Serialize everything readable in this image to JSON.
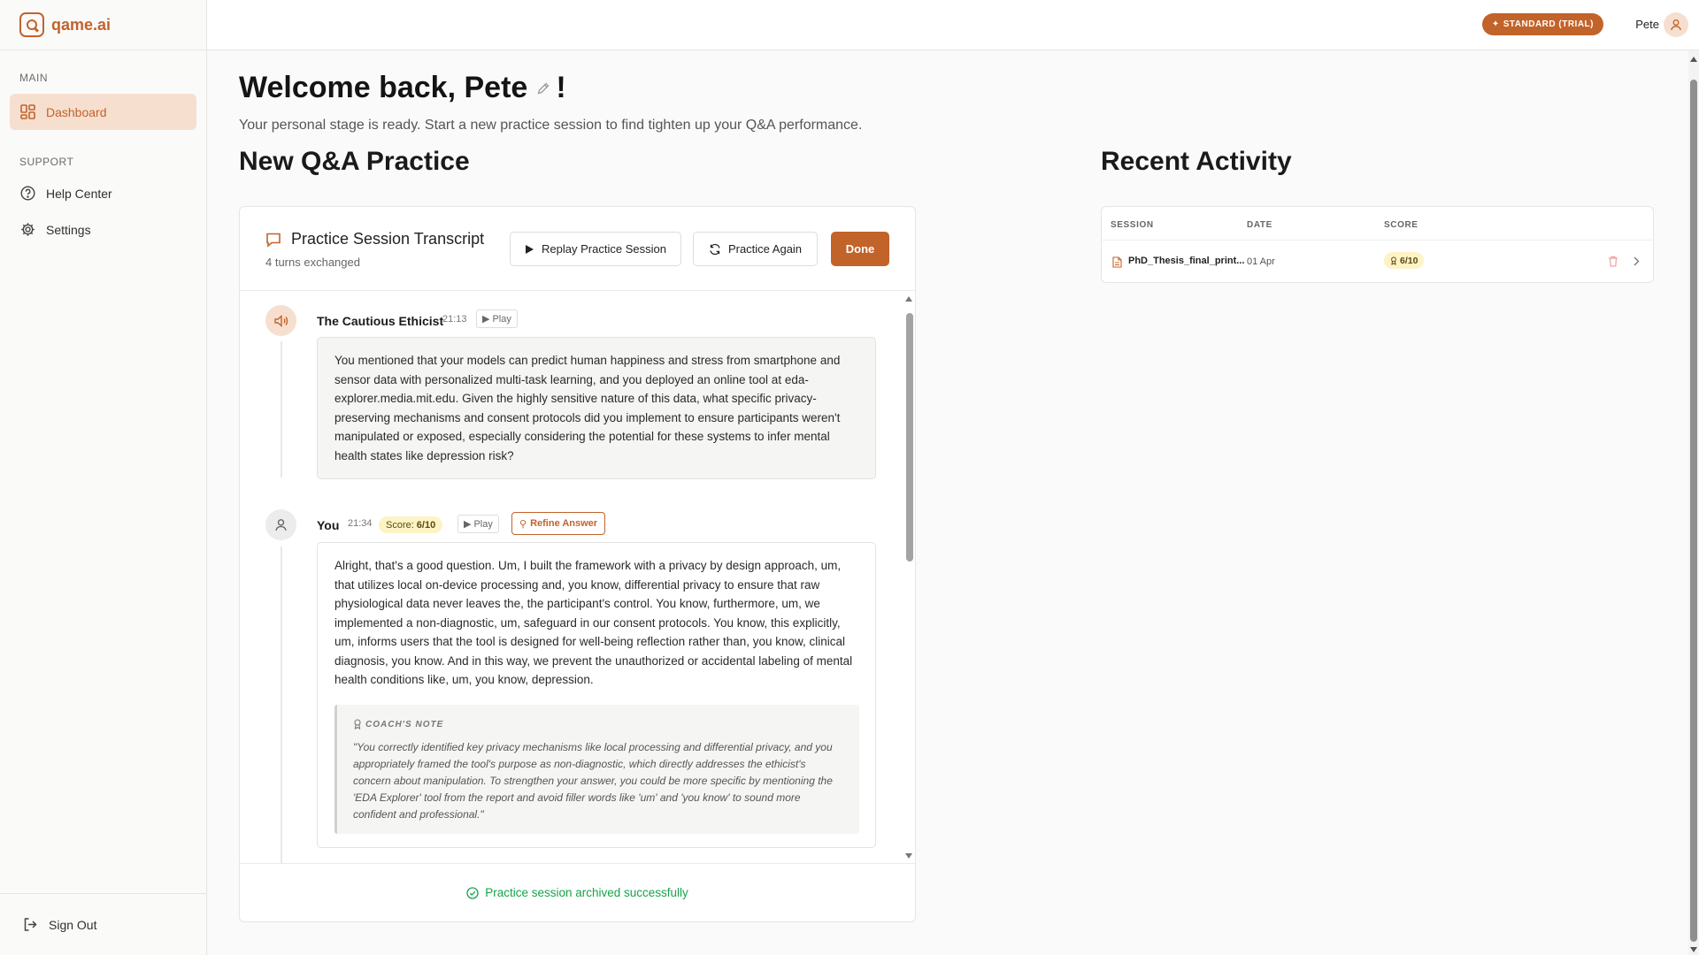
{
  "app": {
    "logo_text": "qame.ai"
  },
  "sidebar": {
    "sections": [
      {
        "label": "MAIN",
        "items": [
          {
            "label": "Dashboard",
            "icon": "dashboard-icon",
            "active": true
          }
        ]
      },
      {
        "label": "SUPPORT",
        "items": [
          {
            "label": "Help Center",
            "icon": "help-icon"
          },
          {
            "label": "Settings",
            "icon": "gear-icon"
          }
        ]
      }
    ],
    "sign_out": "Sign Out"
  },
  "topbar": {
    "plan_badge": "STANDARD (TRIAL)",
    "user_name": "Pete"
  },
  "welcome": {
    "prefix": "Welcome back, ",
    "name": "Pete",
    "suffix": "!",
    "subtitle": "Your personal stage is ready. Start a new practice session to find tighten up your Q&A performance."
  },
  "practice": {
    "section_title": "New Q&A Practice",
    "card_title": "Practice Session Transcript",
    "turns_count": "4 turns exchanged",
    "buttons": {
      "replay": "Replay Practice Session",
      "again": "Practice Again",
      "done": "Done"
    },
    "turns": [
      {
        "speaker": "The Cautious Ethicist",
        "time": "21:13",
        "play": "Play",
        "text": "You mentioned that your models can predict human happiness and stress from smartphone and sensor data with personalized multi-task learning, and you deployed an online tool at eda-explorer.media.mit.edu. Given the highly sensitive nature of this data, what specific privacy-preserving mechanisms and consent protocols did you implement to ensure participants weren't manipulated or exposed, especially considering the potential for these systems to infer mental health states like depression risk?"
      },
      {
        "speaker": "You",
        "time": "21:34",
        "score_label": "Score:",
        "score": "6/10",
        "play": "Play",
        "refine": "Refine Answer",
        "text": "Alright, that's a good question. Um, I built the framework with a privacy by design approach, um, that utilizes local on-device processing and, you know, differential privacy to ensure that raw physiological data never leaves the, the participant's control. You know, furthermore, um, we implemented a non-diagnostic, um, safeguard in our consent protocols. You know, this explicitly, um, informs users that the tool is designed for well-being reflection rather than, you know, clinical diagnosis, you know. And in this way, we prevent the unauthorized or accidental labeling of mental health conditions like, um, you know, depression.",
        "coach_label": "COACH'S NOTE",
        "coach_text": "\"You correctly identified key privacy mechanisms like local processing and differential privacy, and you appropriately framed the tool's purpose as non-diagnostic, which directly addresses the ethicist's concern about manipulation. To strengthen your answer, you could be more specific by mentioning the 'EDA Explorer' tool from the report and avoid filler words like 'um' and 'you know' to sound more confident and professional.\""
      }
    ],
    "status": "Practice session archived successfully"
  },
  "activity": {
    "title": "Recent Activity",
    "columns": [
      "SESSION",
      "DATE",
      "SCORE"
    ],
    "rows": [
      {
        "session": "PhD_Thesis_final_print...",
        "date": "01 Apr",
        "score": "6/10"
      }
    ]
  },
  "colors": {
    "accent": "#c2632a",
    "accent_soft": "#f6dfcf",
    "success": "#15a34a",
    "score_bg": "#fdf3c4"
  }
}
